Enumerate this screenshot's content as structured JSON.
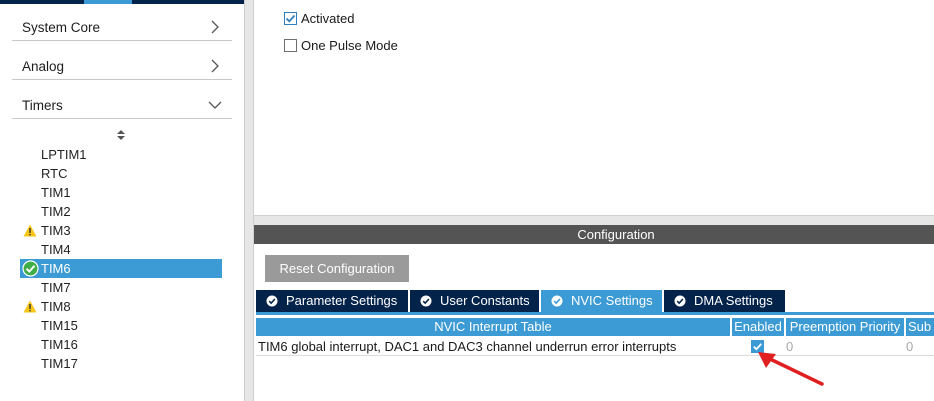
{
  "sidebar": {
    "categories": [
      {
        "label": "System Core",
        "state": "collapsed"
      },
      {
        "label": "Analog",
        "state": "collapsed"
      },
      {
        "label": "Timers",
        "state": "expanded"
      }
    ],
    "peripherals": [
      {
        "label": "LPTIM1",
        "status": "none"
      },
      {
        "label": "RTC",
        "status": "none"
      },
      {
        "label": "TIM1",
        "status": "none"
      },
      {
        "label": "TIM2",
        "status": "none"
      },
      {
        "label": "TIM3",
        "status": "warning"
      },
      {
        "label": "TIM4",
        "status": "none"
      },
      {
        "label": "TIM6",
        "status": "ok",
        "selected": true
      },
      {
        "label": "TIM7",
        "status": "none"
      },
      {
        "label": "TIM8",
        "status": "warning"
      },
      {
        "label": "TIM15",
        "status": "none"
      },
      {
        "label": "TIM16",
        "status": "none"
      },
      {
        "label": "TIM17",
        "status": "none"
      }
    ]
  },
  "mode": {
    "activated": {
      "label": "Activated",
      "checked": true
    },
    "one_pulse": {
      "label": "One Pulse Mode",
      "checked": false
    }
  },
  "configuration": {
    "title": "Configuration",
    "reset_label": "Reset Configuration",
    "tabs": [
      {
        "label": "Parameter Settings",
        "active": false
      },
      {
        "label": "User Constants",
        "active": false
      },
      {
        "label": "NVIC Settings",
        "active": true
      },
      {
        "label": "DMA Settings",
        "active": false
      }
    ],
    "table": {
      "headers": [
        "NVIC Interrupt Table",
        "Enabled",
        "Preemption Priority",
        "Sub"
      ],
      "rows": [
        {
          "name": "TIM6 global interrupt, DAC1 and DAC3 channel underrun error interrupts",
          "enabled": true,
          "preemption": "0",
          "sub": "0"
        }
      ]
    }
  },
  "colors": {
    "accent": "#3c9bd4",
    "navy": "#03234b",
    "warning": "#f5c518",
    "ok": "#3fae49",
    "annotation": "#e02020"
  },
  "icons": {
    "chevron_collapsed": "chevron-right-icon",
    "chevron_expanded": "chevron-down-icon",
    "warning": "warning-icon",
    "ok": "check-circle-icon",
    "tab": "check-circle-icon"
  }
}
